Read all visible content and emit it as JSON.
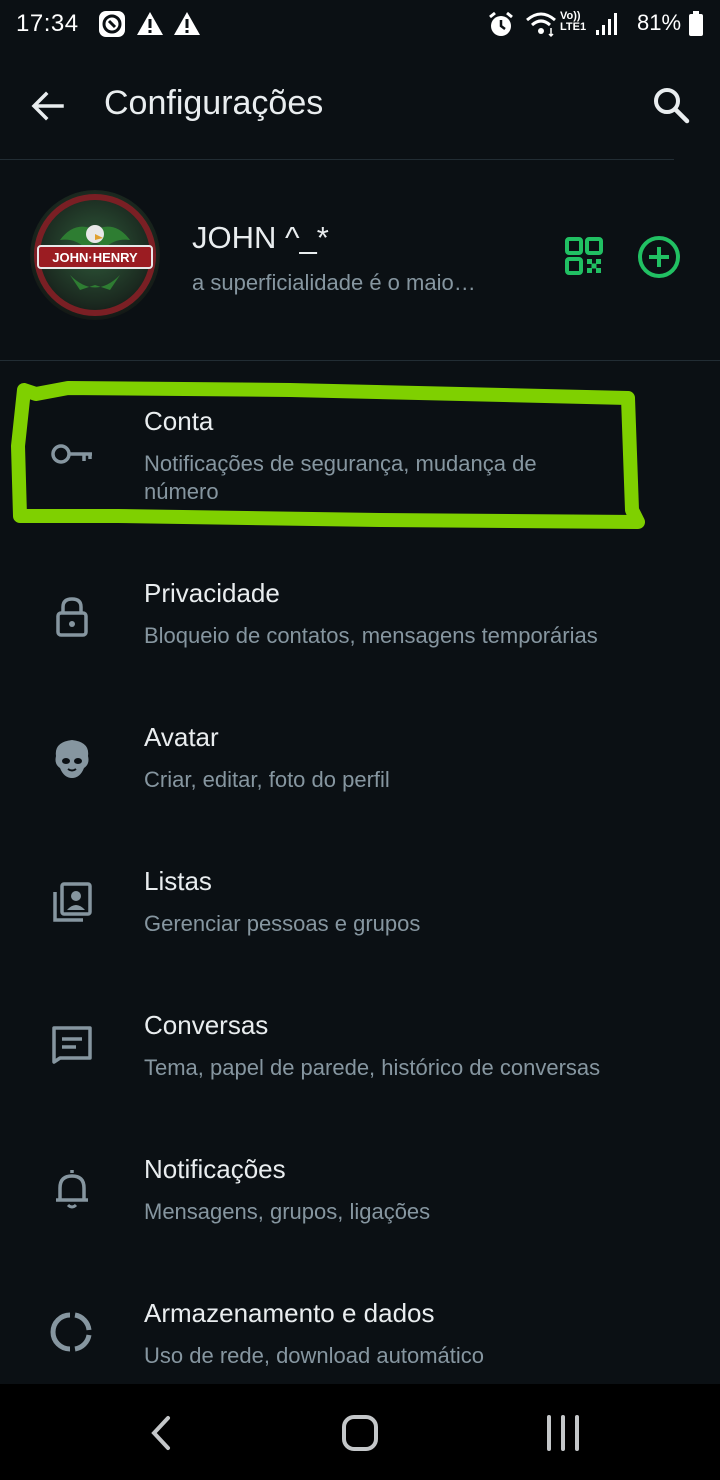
{
  "status_bar": {
    "time": "17:34",
    "battery": "81%",
    "network_label": "Vo)) LTE1",
    "icons": [
      "shazam-icon",
      "warning-icon",
      "warning-icon",
      "alarm-icon",
      "wifi-icon",
      "signal-icon",
      "battery-icon"
    ]
  },
  "header": {
    "title": "Configurações",
    "back_icon": "arrow-left-icon",
    "search_icon": "search-icon"
  },
  "profile": {
    "name": "JOHN ^_*",
    "status": "a superficialidade é o maio…",
    "qr_icon": "qr-code-icon",
    "add_icon": "add-circle-icon",
    "avatar_badge_text": "JOHN·HENRY"
  },
  "settings": [
    {
      "title": "Conta",
      "subtitle": "Notificações de segurança, mudança de número",
      "icon": "key-icon"
    },
    {
      "title": "Privacidade",
      "subtitle": "Bloqueio de contatos, mensagens temporárias",
      "icon": "lock-icon"
    },
    {
      "title": "Avatar",
      "subtitle": "Criar, editar, foto do perfil",
      "icon": "avatar-icon"
    },
    {
      "title": "Listas",
      "subtitle": "Gerenciar pessoas e grupos",
      "icon": "contact-list-icon"
    },
    {
      "title": "Conversas",
      "subtitle": "Tema, papel de parede, histórico de conversas",
      "icon": "chat-icon"
    },
    {
      "title": "Notificações",
      "subtitle": "Mensagens, grupos, ligações",
      "icon": "bell-icon"
    },
    {
      "title": "Armazenamento e dados",
      "subtitle": "Uso de rede, download automático",
      "icon": "storage-icon"
    }
  ],
  "colors": {
    "background": "#0b1014",
    "accent": "#21c063",
    "highlight_marker": "#7fd000",
    "primary_text": "#e9edef",
    "secondary_text": "#8696a0"
  }
}
